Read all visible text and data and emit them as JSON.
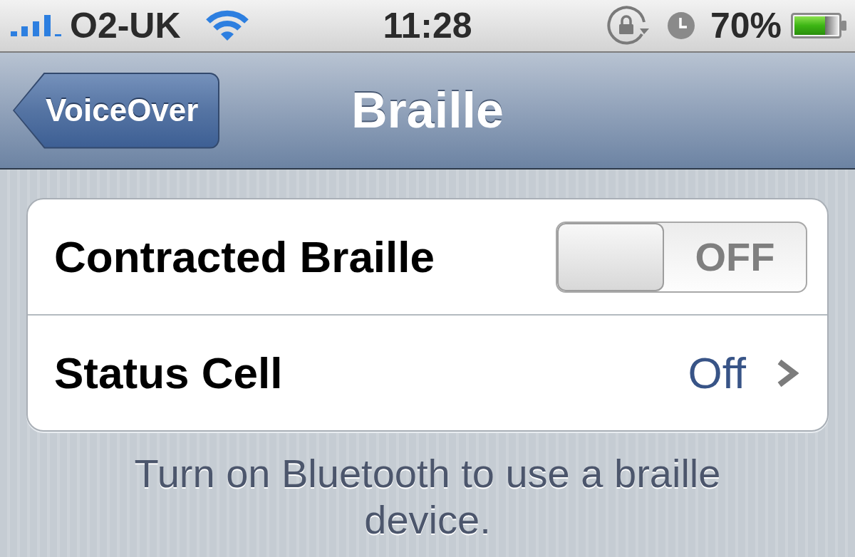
{
  "status_bar": {
    "carrier": "O2-UK",
    "time": "11:28",
    "battery_percent": "70%"
  },
  "nav_bar": {
    "back_button": "VoiceOver",
    "title": "Braille"
  },
  "settings": [
    {
      "kind": "toggle",
      "label": "Contracted Braille",
      "on": false,
      "state_text": "OFF"
    },
    {
      "kind": "disclosure",
      "label": "Status Cell",
      "value": "Off"
    }
  ],
  "footer": "Turn on Bluetooth to use a braille device."
}
